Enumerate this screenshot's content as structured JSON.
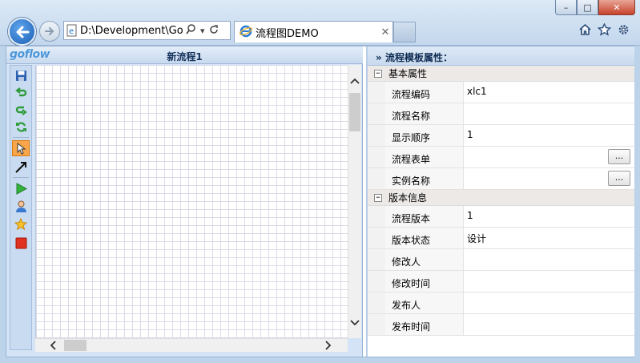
{
  "browser": {
    "address": "D:\\Development\\GoFlow",
    "tab_title": "流程图DEMO",
    "window_buttons": [
      "–",
      "□",
      "✕"
    ]
  },
  "designer": {
    "logo": "goflow",
    "title": "新流程1",
    "tools": [
      "save-icon",
      "undo-icon",
      "redo-icon",
      "refresh-icon",
      "pointer-icon",
      "connector-arrow-icon",
      "start-node-icon",
      "user-node-icon",
      "star-node-icon",
      "end-node-icon"
    ],
    "active_tool": "pointer-icon"
  },
  "properties": {
    "header": "流程模板属性：",
    "groups": [
      {
        "title": "基本属性",
        "rows": [
          {
            "key": "流程编码",
            "value": "xlc1",
            "has_button": false
          },
          {
            "key": "流程名称",
            "value": "",
            "has_button": false
          },
          {
            "key": "显示顺序",
            "value": "1",
            "has_button": false
          },
          {
            "key": "流程表单",
            "value": "",
            "has_button": true
          },
          {
            "key": "实例名称",
            "value": "",
            "has_button": true
          }
        ]
      },
      {
        "title": "版本信息",
        "rows": [
          {
            "key": "流程版本",
            "value": "1"
          },
          {
            "key": "版本状态",
            "value": "设计"
          },
          {
            "key": "修改人",
            "value": ""
          },
          {
            "key": "修改时间",
            "value": ""
          },
          {
            "key": "发布人",
            "value": ""
          },
          {
            "key": "发布时间",
            "value": ""
          }
        ]
      }
    ],
    "button_label": "..."
  }
}
